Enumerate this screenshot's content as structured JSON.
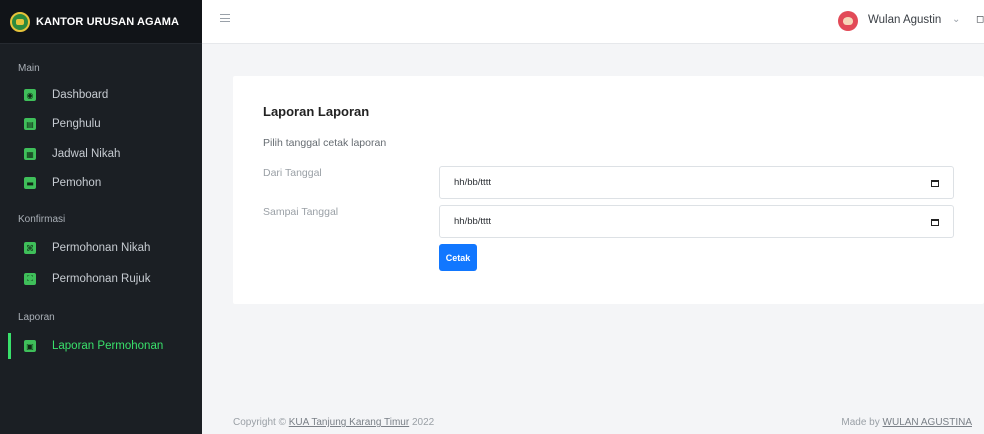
{
  "brand": {
    "title": "KANTOR URUSAN AGAMA"
  },
  "sidebar": {
    "sections": [
      {
        "label": "Main"
      },
      {
        "label": "Konfirmasi"
      },
      {
        "label": "Laporan"
      }
    ],
    "items": [
      {
        "label": "Dashboard",
        "icon": "dashboard-icon",
        "glyph": "◉"
      },
      {
        "label": "Penghulu",
        "icon": "id-card-icon",
        "glyph": "▤"
      },
      {
        "label": "Jadwal Nikah",
        "icon": "calendar-icon",
        "glyph": "▦"
      },
      {
        "label": "Pemohon",
        "icon": "contact-card-icon",
        "glyph": "▬"
      },
      {
        "label": "Permohonan Nikah",
        "icon": "command-icon",
        "glyph": "⌘"
      },
      {
        "label": "Permohonan Rujuk",
        "icon": "cross-icon",
        "glyph": "⛶"
      },
      {
        "label": "Laporan Permohonan",
        "icon": "printer-icon",
        "glyph": "▣",
        "active": true
      }
    ]
  },
  "topbar": {
    "user_name": "Wulan Agustin",
    "caret": "⌄",
    "bell": "◻"
  },
  "card": {
    "title": "Laporan Laporan",
    "hint": "Pilih tanggal cetak laporan",
    "from_label": "Dari Tanggal",
    "to_label": "Sampai Tanggal",
    "from_value": "hh/bb/tttt",
    "to_value": "hh/bb/tttt",
    "submit_label": "Cetak"
  },
  "footer": {
    "copyright_prefix": "Copyright ©",
    "copyright_link": "KUA Tanjung Karang Timur",
    "copyright_year": "2022",
    "made_by_prefix": "Made by",
    "made_by_link": "WULAN AGUSTINA"
  },
  "colors": {
    "sidebar_bg": "#1b1f24",
    "accent_green": "#39e06b",
    "button_blue": "#1177ff"
  }
}
